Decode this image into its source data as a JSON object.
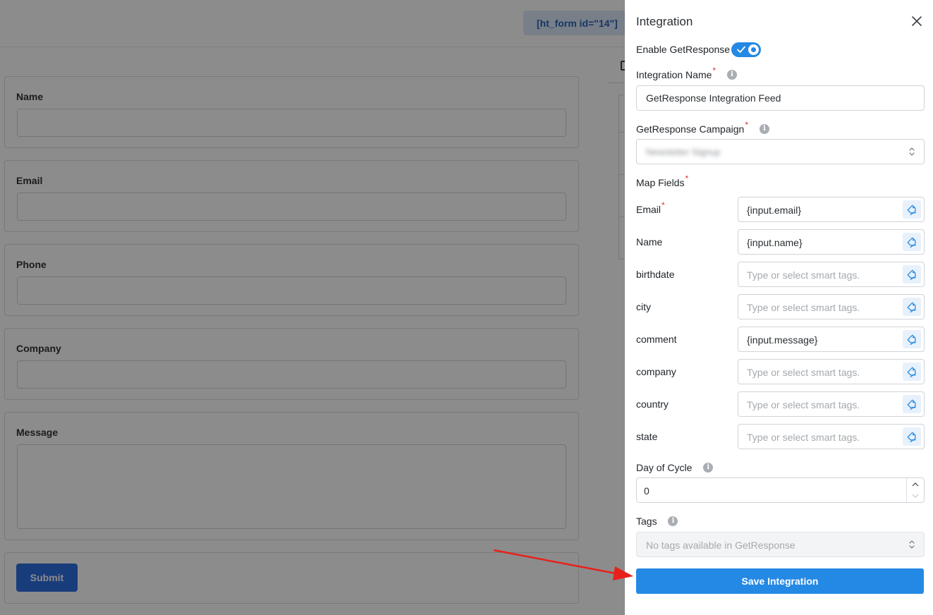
{
  "background_form": {
    "shortcode": "[ht_form id=\"14\"]",
    "fields": [
      {
        "label": "Name"
      },
      {
        "label": "Email"
      },
      {
        "label": "Phone"
      },
      {
        "label": "Company"
      },
      {
        "label": "Message"
      }
    ],
    "submit_label": "Submit"
  },
  "drawer": {
    "title": "Integration",
    "enable_label": "Enable GetResponse",
    "enable_on": true,
    "integration_name": {
      "label": "Integration Name",
      "required_mark": "*",
      "value": "GetResponse Integration Feed"
    },
    "campaign": {
      "label": "GetResponse Campaign",
      "required_mark": "*",
      "selected": "Newsletter Signup"
    },
    "map_fields": {
      "label": "Map Fields",
      "required_mark": "*",
      "placeholder": "Type or select smart tags.",
      "rows": [
        {
          "label": "Email",
          "required": true,
          "value": "{input.email}"
        },
        {
          "label": "Name",
          "required": false,
          "value": "{input.name}"
        },
        {
          "label": "birthdate",
          "required": false,
          "value": ""
        },
        {
          "label": "city",
          "required": false,
          "value": ""
        },
        {
          "label": "comment",
          "required": false,
          "value": "{input.message}"
        },
        {
          "label": "company",
          "required": false,
          "value": ""
        },
        {
          "label": "country",
          "required": false,
          "value": ""
        },
        {
          "label": "state",
          "required": false,
          "value": ""
        }
      ]
    },
    "day_of_cycle": {
      "label": "Day of Cycle",
      "value": "0"
    },
    "tags": {
      "label": "Tags",
      "placeholder": "No tags available in GetResponse"
    },
    "save_label": "Save Integration"
  },
  "colors": {
    "accent": "#2489e4",
    "required": "#e03131",
    "annotation_arrow": "#e8201c"
  },
  "icons": {
    "close": "close-icon",
    "info": "info-icon",
    "smart_tag": "tag-icon",
    "select": "chevron-up-down-icon"
  }
}
